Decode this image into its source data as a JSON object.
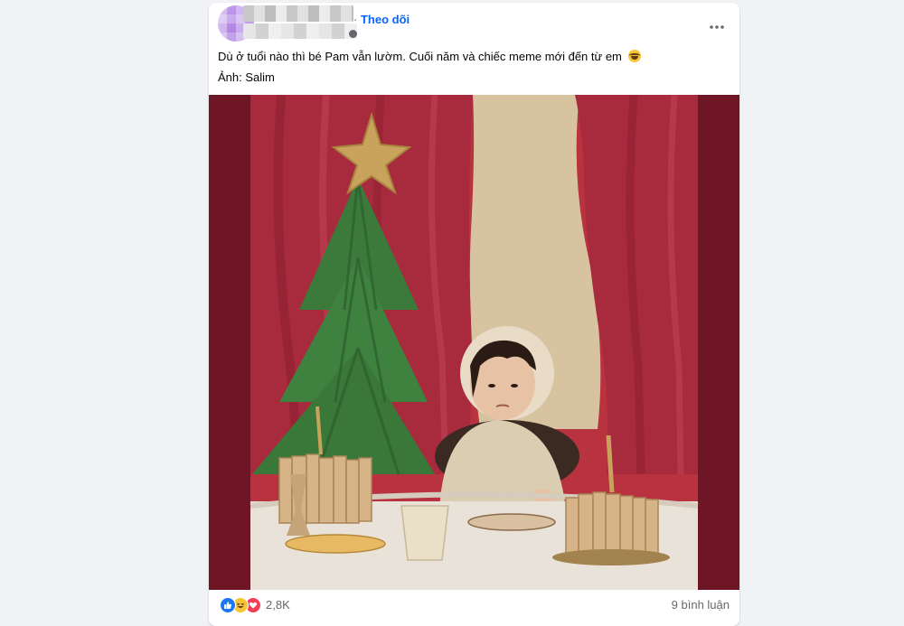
{
  "post": {
    "follow_separator": "·",
    "follow_label": "Theo dõi",
    "caption": "Dù ở tuổi nào thì bé Pam vẫn lườm. Cuối năm và chiếc meme mới đến từ em",
    "credit": "Ảnh: Salim",
    "reactions": {
      "types": [
        "like-icon",
        "haha-icon",
        "love-icon"
      ],
      "count": "2,8K"
    },
    "comments": "9 bình luận"
  },
  "colors": {
    "link": "#0866ff",
    "like": "#1877f2",
    "haha": "#f7c533",
    "love": "#f33e58",
    "photo_frame": "#6e1526",
    "curtain": "#9f2a3c",
    "wall": "#d8c3a1",
    "tree": "#3c7a3c",
    "star": "#c9a25b"
  }
}
